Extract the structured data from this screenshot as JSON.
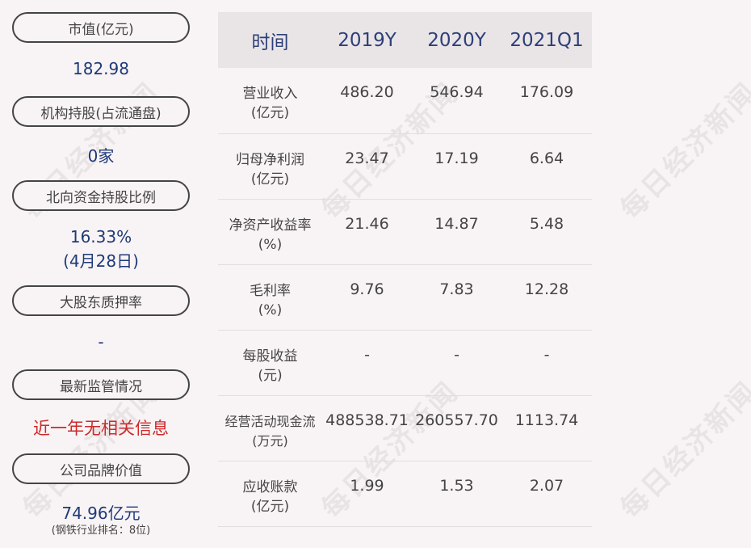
{
  "left": {
    "items": [
      {
        "label": "市值(亿元)",
        "value": "182.98"
      },
      {
        "label": "机构持股(占流通盘)",
        "value": "0家"
      },
      {
        "label": "北向资金持股比例",
        "value": "16.33%",
        "value2": "(4月28日)"
      },
      {
        "label": "大股东质押率",
        "value": "-"
      },
      {
        "label": "最新监管情况",
        "value": "近一年无相关信息"
      },
      {
        "label": "公司品牌价值",
        "value": "74.96亿元",
        "note": "(钢铁行业排名：8位)"
      }
    ]
  },
  "table": {
    "headers": [
      "时间",
      "2019Y",
      "2020Y",
      "2021Q1"
    ],
    "rows": [
      {
        "name1": "营业收入",
        "name2": "(亿元)",
        "values": [
          "486.20",
          "546.94",
          "176.09"
        ]
      },
      {
        "name1": "归母净利润",
        "name2": "(亿元)",
        "values": [
          "23.47",
          "17.19",
          "6.64"
        ]
      },
      {
        "name1": "净资产收益率",
        "name2": "(%)",
        "values": [
          "21.46",
          "14.87",
          "5.48"
        ]
      },
      {
        "name1": "毛利率",
        "name2": "(%)",
        "values": [
          "9.76",
          "7.83",
          "12.28"
        ]
      },
      {
        "name1": "每股收益",
        "name2": "(元)",
        "values": [
          "-",
          "-",
          "-"
        ]
      },
      {
        "name1": "经营活动现金流",
        "name2": "(万元)",
        "values": [
          "488538.71",
          "260557.70",
          "1113.74"
        ]
      },
      {
        "name1": "应收账款",
        "name2": "(亿元)",
        "values": [
          "1.99",
          "1.53",
          "2.07"
        ]
      }
    ]
  },
  "watermark": "每日经济新闻"
}
